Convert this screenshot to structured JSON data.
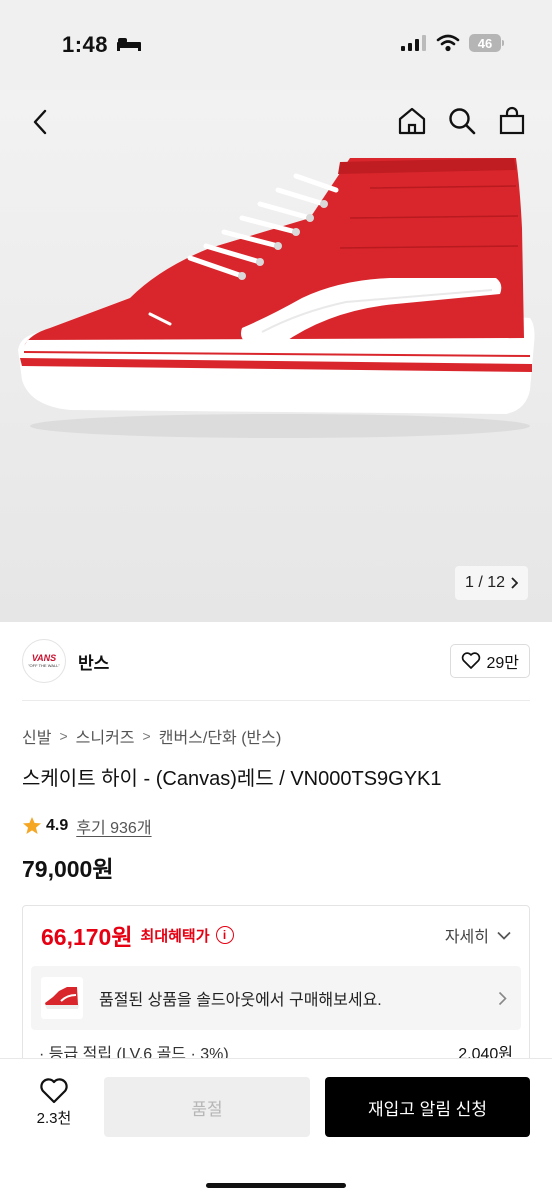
{
  "status_bar": {
    "time": "1:48",
    "battery": "46"
  },
  "gallery": {
    "counter": "1 / 12"
  },
  "brand": {
    "logo_text": "VANS",
    "logo_tagline": "\"OFF THE WALL\"",
    "name": "반스",
    "likes": "29만"
  },
  "breadcrumb": [
    "신발",
    "스니커즈",
    "캔버스/단화 (반스)"
  ],
  "product": {
    "title": "스케이트 하이 - (Canvas)레드 / VN000TS9GYK1",
    "rating": "4.9",
    "reviews": "후기 936개",
    "price": "79,000원"
  },
  "benefit": {
    "sale_price": "66,170원",
    "label": "최대혜택가",
    "info_symbol": "i",
    "detail_label": "자세히",
    "soldout_message": "품절된 상품을 솔드아웃에서 구매해보세요.",
    "points_label": "· 등급 적립 (LV.6 골드 · 3%)",
    "points_value": "2,040원"
  },
  "bottom": {
    "wish_count": "2.3천",
    "soldout_label": "품절",
    "restock_label": "재입고 알림 신청"
  },
  "colors": {
    "accent": "#e60012",
    "shoe_red": "#d9262c",
    "star": "#f5a623"
  },
  "icons": [
    "bed-icon",
    "signal-icon",
    "wifi-icon",
    "back-icon",
    "home-icon",
    "search-icon",
    "shopping-bag-icon",
    "heart-icon",
    "star-icon",
    "info-icon",
    "chevron-down-icon",
    "chevron-right-icon"
  ]
}
